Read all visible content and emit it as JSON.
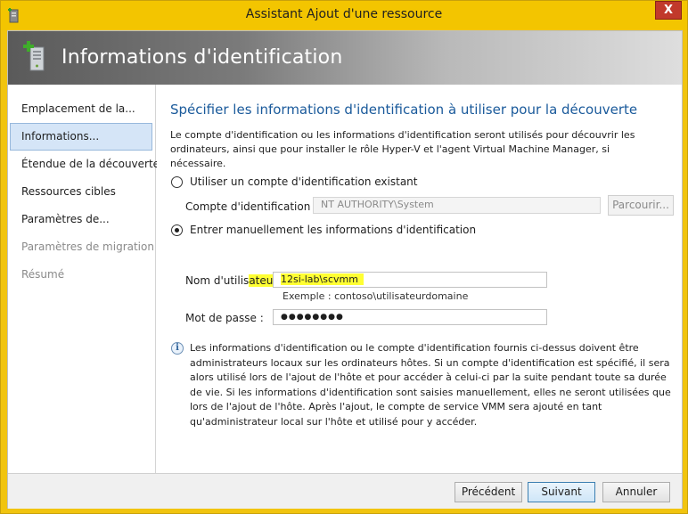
{
  "window": {
    "title": "Assistant Ajout d'une ressource",
    "close_glyph": "X"
  },
  "banner": {
    "title": "Informations d'identification",
    "icon": "server-add-icon"
  },
  "nav": {
    "items": [
      {
        "label": "Emplacement de la...",
        "state": "normal"
      },
      {
        "label": "Informations...",
        "state": "active"
      },
      {
        "label": "Étendue de la découverte",
        "state": "normal"
      },
      {
        "label": "Ressources cibles",
        "state": "normal"
      },
      {
        "label": "Paramètres de...",
        "state": "normal"
      },
      {
        "label": "Paramètres de migration",
        "state": "disabled"
      },
      {
        "label": "Résumé",
        "state": "disabled"
      }
    ]
  },
  "main": {
    "heading": "Spécifier les informations d'identification à utiliser pour la découverte",
    "description": "Le compte d'identification ou les informations d'identification seront utilisés pour découvrir les ordinateurs, ainsi que pour installer le rôle Hyper-V et l'agent Virtual Machine Manager, si nécessaire.",
    "option_existing": {
      "label": "Utiliser un compte d'identification existant",
      "checked": false,
      "field_label": "Compte d'identification :",
      "field_value": "NT AUTHORITY\\System",
      "browse_label": "Parcourir..."
    },
    "option_manual": {
      "label": "Entrer manuellement les informations d'identification",
      "checked": true,
      "username_label_a": "Nom d'utilis",
      "username_label_b": "ateur :",
      "username_value": "12si-lab\\scvmm",
      "username_hint": "Exemple : contoso\\utilisateurdomaine",
      "password_label": "Mot de passe :",
      "password_value": "●●●●●●●●"
    },
    "info": {
      "icon": "info-icon",
      "glyph": "i",
      "text": "Les informations d'identification ou le compte d'identification fournis ci-dessus doivent être administrateurs locaux sur les ordinateurs hôtes. Si un compte d'identification est spécifié, il sera alors utilisé lors de l'ajout de l'hôte et pour accéder à celui-ci par la suite pendant toute sa durée de vie. Si les informations d'identification sont saisies manuellement, elles ne seront utilisées que lors de l'ajout de l'hôte. Après l'ajout, le compte de service VMM sera ajouté en tant qu'administrateur local sur l'hôte et utilisé pour y accéder."
    }
  },
  "footer": {
    "previous_label": "Précédent",
    "next_label": "Suivant",
    "cancel_label": "Annuler"
  },
  "colors": {
    "titlebar": "#f3c500",
    "heading": "#1a5a9b",
    "highlight": "#ffff33",
    "nav_active": "#d5e5f7"
  }
}
